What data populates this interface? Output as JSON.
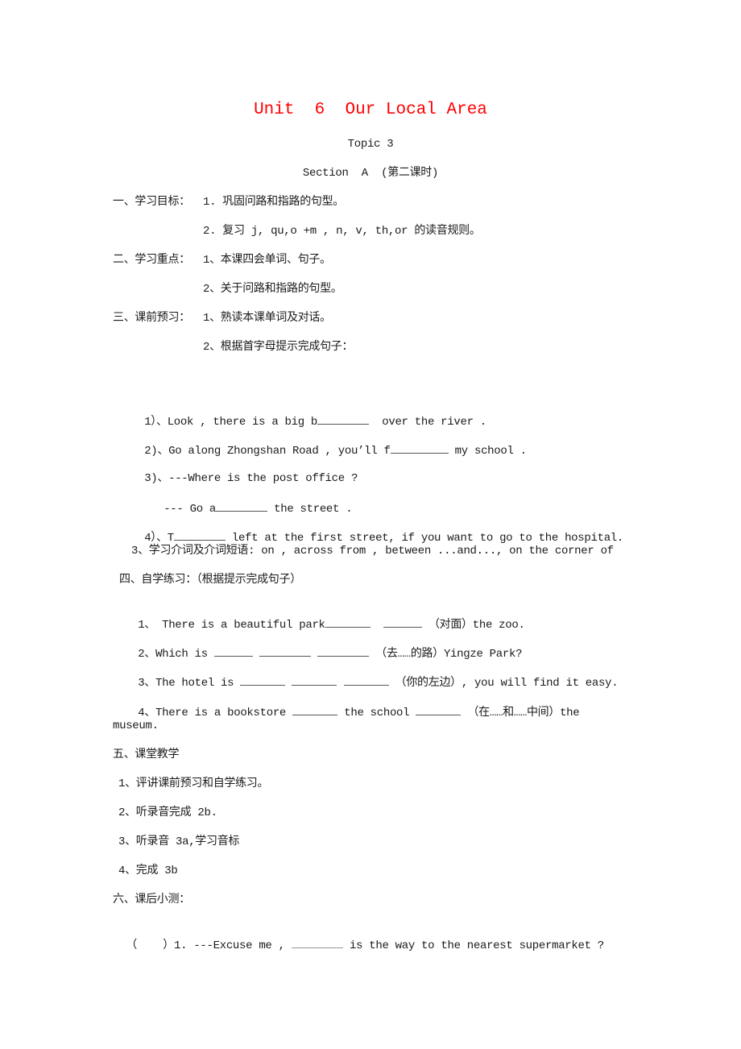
{
  "document": {
    "title": "Unit  6  Our Local Area",
    "topic": "Topic 3",
    "section": "Section  A  (第二课时)",
    "title_color": "#ff0000"
  },
  "objectives": {
    "heading": "一、学习目标：",
    "item1": "1. 巩固问路和指路的句型。",
    "item2": "2. 复习 j, qu,o +m , n, v, th,or 的读音规则。"
  },
  "key_points": {
    "heading": "二、学习重点：",
    "item1": "1、本课四会单词、句子。",
    "item2": "2、关于问路和指路的句型。"
  },
  "preview": {
    "heading": "三、课前预习：",
    "item1": "1、熟读本课单词及对话。",
    "item2": "2、根据首字母提示完成句子：",
    "sentences": [
      {
        "pre": "1）、Look , there is a big b",
        "post": "  over the river ."
      },
      {
        "pre": "2)、Go along Zhongshan Road , you’ll f",
        "post": " my school ."
      },
      {
        "pre": "3)、---Where is the post office ?",
        "post": ""
      },
      {
        "pre": "--- Go a",
        "post": " the street ."
      },
      {
        "pre": "4）、T",
        "post": " left at the first street, if you want to go to the hospital."
      }
    ],
    "item3": "3、学习介词及介词短语: on , across from , between ...and..., on the corner of"
  },
  "self_study": {
    "heading": "四、自学练习：（根据提示完成句子）",
    "q1": {
      "pre": "1、 There is a beautiful park",
      "hint": "（对面）the zoo."
    },
    "q2": {
      "pre": "2、Which is ",
      "hint": "（去……的路）Yingze Park?"
    },
    "q3": {
      "pre": "3、The hotel is ",
      "hint": "（你的左边）, you will find it easy."
    },
    "q4": {
      "pre": "4、There is a bookstore ",
      "mid": " the school ",
      "hint": "（在……和……中间）the",
      "cont": "museum."
    }
  },
  "classroom": {
    "heading": "五、课堂教学",
    "items": [
      "1、评讲课前预习和自学练习。",
      "2、听录音完成 2b.",
      "3、听录音 3a,学习音标",
      "4、完成 3b"
    ]
  },
  "quiz": {
    "heading": "六、课后小测：",
    "q1": {
      "bracket": "（    ）1. ---Excuse me , ",
      "post": " is the way to the nearest supermarket ?"
    }
  }
}
